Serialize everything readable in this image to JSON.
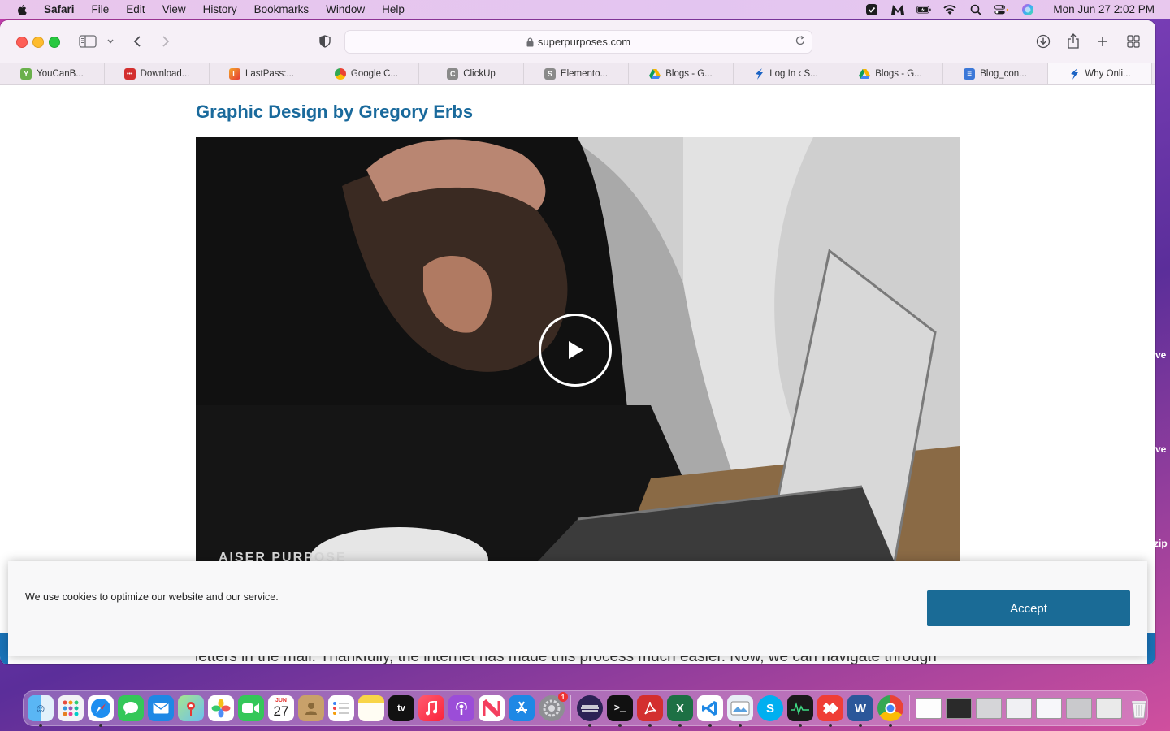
{
  "menubar": {
    "app_name": "Safari",
    "items": [
      "File",
      "Edit",
      "View",
      "History",
      "Bookmarks",
      "Window",
      "Help"
    ],
    "clock": "Mon Jun 27  2:02 PM"
  },
  "toolbar": {
    "url": "superpurposes.com"
  },
  "tabs": [
    {
      "label": "YouCanB...",
      "color": "#6ab04c",
      "glyph": "Y"
    },
    {
      "label": "Download...",
      "color": "#d32f2f",
      "glyph": "•••"
    },
    {
      "label": "LastPass:...",
      "color": "#f4a62a",
      "glyph": "L"
    },
    {
      "label": "Google C...",
      "color": "#4285f4",
      "glyph": "G"
    },
    {
      "label": "ClickUp",
      "color": "#8a8a8a",
      "glyph": "C"
    },
    {
      "label": "Elemento...",
      "color": "#8a8a8a",
      "glyph": "S"
    },
    {
      "label": "Blogs - G...",
      "color": "#f6b400",
      "glyph": "▲"
    },
    {
      "label": "Log In ‹ S...",
      "color": "#1b63c4",
      "glyph": "➤"
    },
    {
      "label": "Blogs - G...",
      "color": "#f6b400",
      "glyph": "▲"
    },
    {
      "label": "Blog_con...",
      "color": "#3c78d8",
      "glyph": "≡"
    },
    {
      "label": "Why Onli...",
      "color": "#1b63c4",
      "glyph": "➤"
    }
  ],
  "page": {
    "title": "Graphic Design by Gregory Erbs",
    "video_watermark": "AISER PURPOSE",
    "edge_labels": [
      "ve",
      "ve",
      "zip"
    ],
    "bottom_text": "letters in the mail. Thankfully, the internet has made this process much easier. Now, we can navigate through"
  },
  "cookie_banner": {
    "message": "We use cookies to optimize our website and our service.",
    "accept_label": "Accept"
  },
  "dock": {
    "calendar_day": "27",
    "calendar_month": "JUN",
    "settings_badge": "1"
  }
}
